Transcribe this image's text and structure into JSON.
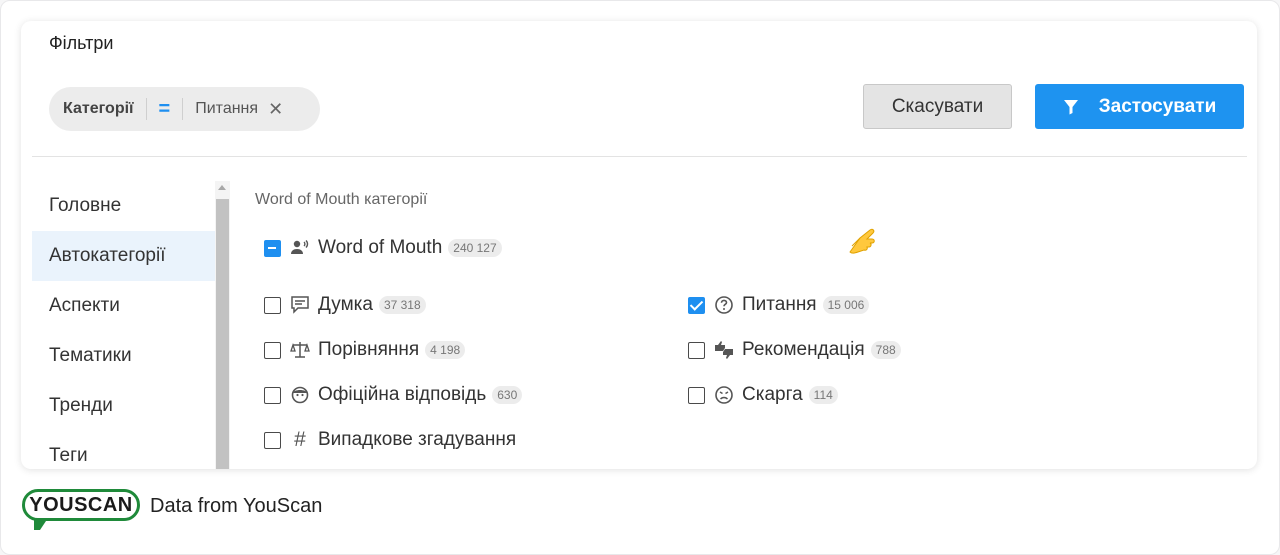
{
  "panel": {
    "title": "Фільтри"
  },
  "filter_chip": {
    "category": "Категорії",
    "operator": "=",
    "value": "Питання",
    "remove_icon": "close-icon"
  },
  "buttons": {
    "cancel_label": "Скасувати",
    "apply_label": "Застосувати",
    "apply_icon": "funnel-icon"
  },
  "sidebar": {
    "items": [
      {
        "label": "Головне",
        "active": false
      },
      {
        "label": "Автокатегорії",
        "active": true
      },
      {
        "label": "Аспекти",
        "active": false
      },
      {
        "label": "Тематики",
        "active": false
      },
      {
        "label": "Тренди",
        "active": false
      },
      {
        "label": "Теги",
        "active": false
      }
    ]
  },
  "main": {
    "section_title": "Word of Mouth категорії",
    "parent": {
      "label": "Word of Mouth",
      "count": "240 127",
      "state": "partial",
      "icon": "speaking-person-icon"
    },
    "categories": [
      {
        "label": "Думка",
        "count": "37 318",
        "checked": false,
        "icon": "comment-icon"
      },
      {
        "label": "Питання",
        "count": "15 006",
        "checked": true,
        "icon": "question-circle-icon"
      },
      {
        "label": "Порівняння",
        "count": "4 198",
        "checked": false,
        "icon": "scales-icon"
      },
      {
        "label": "Рекомендація",
        "count": "788",
        "checked": false,
        "icon": "thumbs-icon"
      },
      {
        "label": "Офіційна відповідь",
        "count": "630",
        "checked": false,
        "icon": "support-agent-icon"
      },
      {
        "label": "Скарга",
        "count": "114",
        "checked": false,
        "icon": "angry-face-icon"
      },
      {
        "label": "Випадкове згадування",
        "count": "",
        "checked": false,
        "icon": "hash-icon"
      }
    ]
  },
  "footer": {
    "logo_text": "YOUSCAN",
    "text": "Data from YouScan"
  },
  "colors": {
    "accent": "#1e93f0",
    "logo_green": "#1f8a3a",
    "active_bg": "#eaf3fc"
  }
}
